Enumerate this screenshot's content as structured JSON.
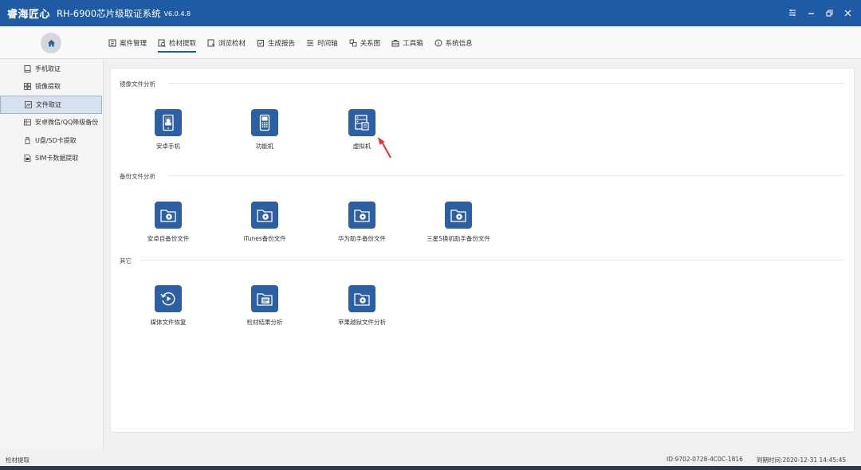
{
  "window": {
    "app_name": "睿海匠心",
    "app_subtitle": "RH-6900芯片级取证系统",
    "version": "V6.0.4.8",
    "accent_color": "#1f5ba4"
  },
  "toolbar": {
    "home_icon": "home-icon",
    "nav": [
      {
        "label": "案件管理",
        "icon": "case-icon"
      },
      {
        "label": "检材提取",
        "icon": "extract-icon",
        "active": true
      },
      {
        "label": "浏览检材",
        "icon": "browse-icon"
      },
      {
        "label": "生成报告",
        "icon": "report-icon"
      },
      {
        "label": "时间轴",
        "icon": "timeline-icon"
      },
      {
        "label": "关系图",
        "icon": "relation-icon"
      },
      {
        "label": "工具箱",
        "icon": "toolbox-icon"
      },
      {
        "label": "系统信息",
        "icon": "info-icon"
      }
    ]
  },
  "sidebar": {
    "items": [
      {
        "label": "手机取证",
        "icon": "phone-icon"
      },
      {
        "label": "镜像提取",
        "icon": "image-icon"
      },
      {
        "label": "文件取证",
        "icon": "file-chart-icon",
        "active": true
      },
      {
        "label": "安卓微信/QQ降级备份",
        "icon": "backup-icon"
      },
      {
        "label": "U盘/SD卡提取",
        "icon": "usb-icon"
      },
      {
        "label": "SIM卡数据提取",
        "icon": "sim-icon"
      }
    ]
  },
  "main": {
    "sections": [
      {
        "title": "镜像文件分析",
        "tiles": [
          {
            "label": "安卓手机",
            "icon": "android-phone-icon"
          },
          {
            "label": "功能机",
            "icon": "feature-phone-icon"
          },
          {
            "label": "虚拟机",
            "icon": "virtual-machine-icon"
          }
        ]
      },
      {
        "title": "备份文件分析",
        "tiles": [
          {
            "label": "安卓自备份文件",
            "icon": "folder-disc-icon"
          },
          {
            "label": "iTunes备份文件",
            "icon": "folder-disc-icon"
          },
          {
            "label": "华为助手备份文件",
            "icon": "folder-disc-icon"
          },
          {
            "label": "三星S换机助手备份文件",
            "icon": "folder-disc-icon"
          }
        ]
      },
      {
        "title": "其它",
        "tiles": [
          {
            "label": "媒体文件恢复",
            "icon": "media-restore-icon"
          },
          {
            "label": "检材结果分析",
            "icon": "folder-list-icon"
          },
          {
            "label": "苹果越狱文件分析",
            "icon": "folder-disc-icon"
          }
        ]
      }
    ]
  },
  "statusbar": {
    "left": "检材提取",
    "device_id": "ID:9702-0728-4C0C-1816",
    "expiry": "到期时间:2020-12-31 14:45:45"
  }
}
